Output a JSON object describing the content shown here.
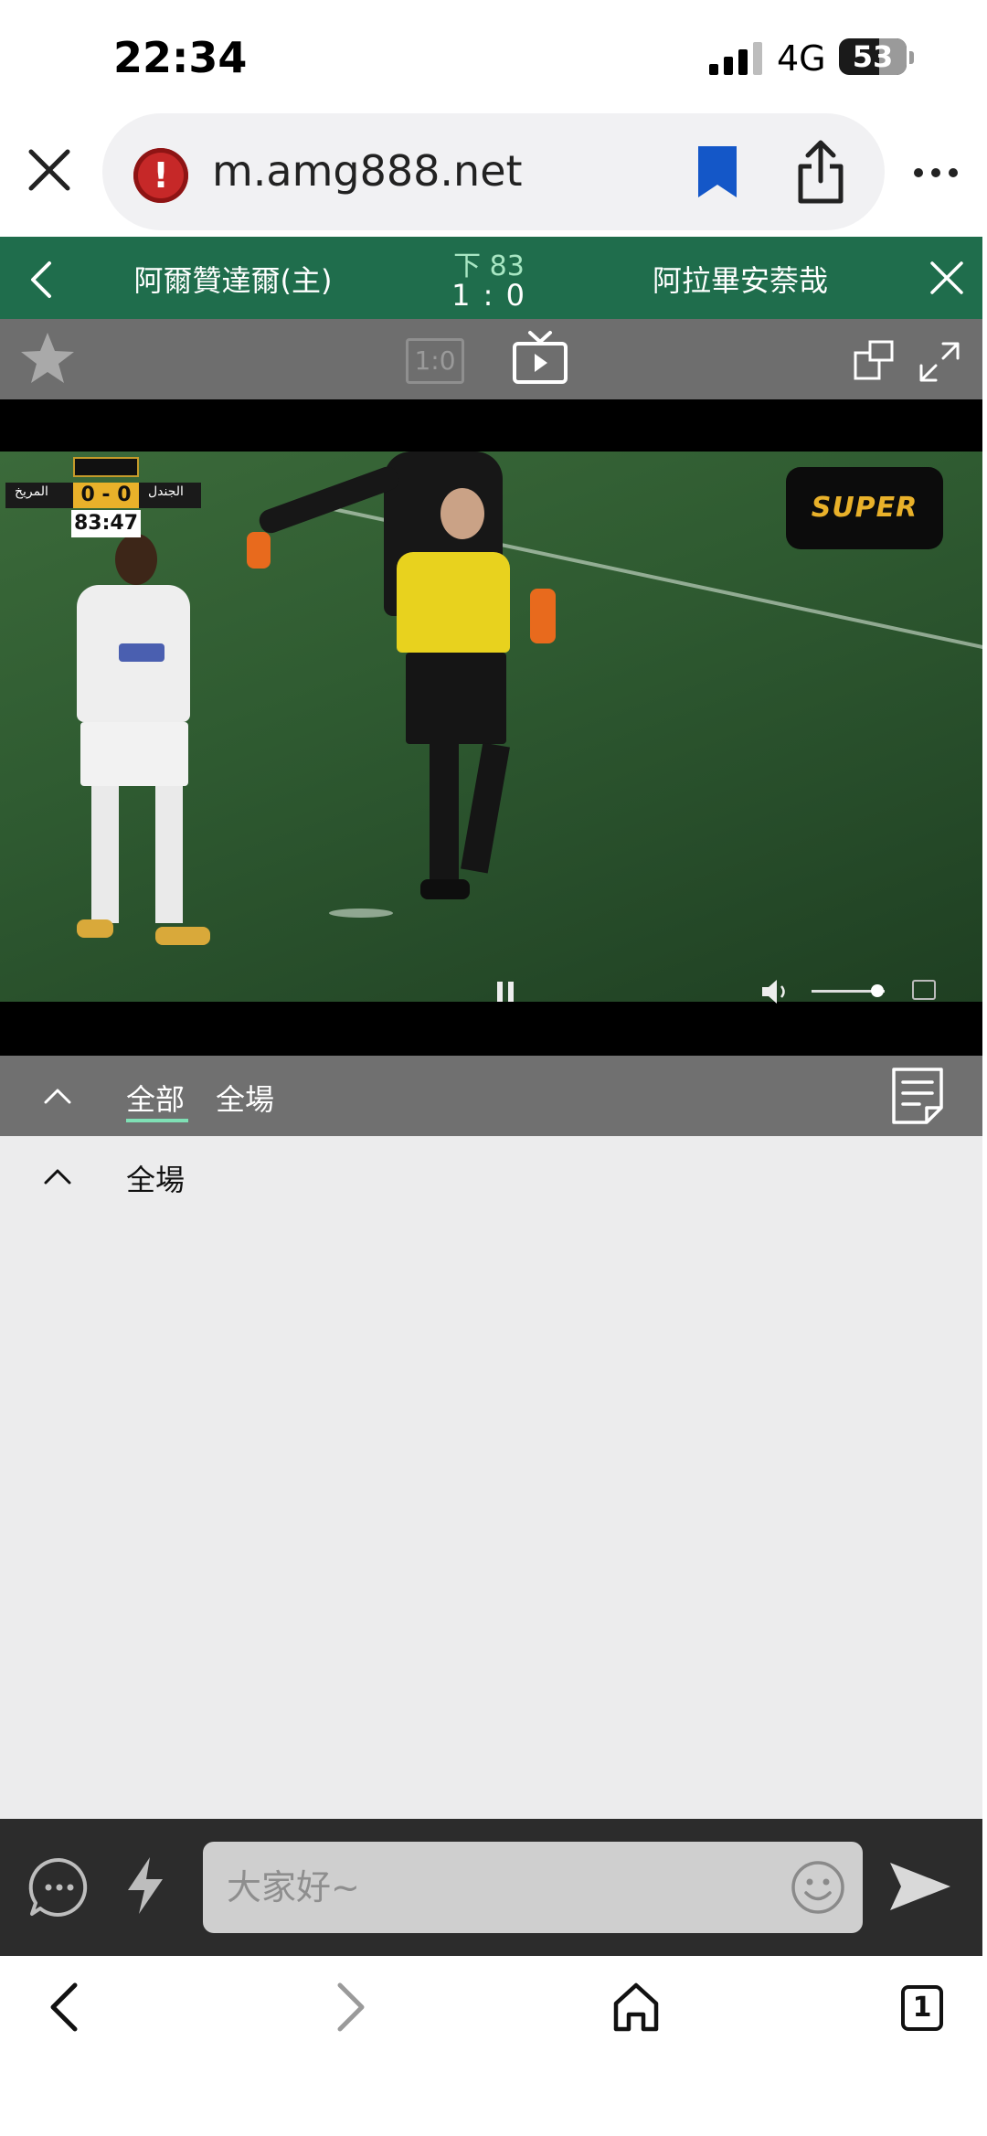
{
  "status_bar": {
    "time": "22:34",
    "network": "4G",
    "battery": "53"
  },
  "browser": {
    "url": "m.amg888.net",
    "warning_icon": "!"
  },
  "match": {
    "home_team": "阿爾贊達爾(主)",
    "away_team": "阿拉畢安萘哉",
    "period": "下 83",
    "score": "1 : 0",
    "score_icon_label": "1:0"
  },
  "video": {
    "scorebug_score": "0 - 0",
    "scorebug_clock": "83:47",
    "scorebug_team_left": "المريخ",
    "scorebug_team_right": "الجندل",
    "channel_logo": "SUPER",
    "volume_level": 0.9
  },
  "tabs": [
    {
      "label": "全部",
      "active": true
    },
    {
      "label": "全場",
      "active": false
    }
  ],
  "content": {
    "section_title": "全場"
  },
  "chat": {
    "placeholder": "大家好~"
  },
  "bottom_nav": {
    "tab_count": "1"
  },
  "colors": {
    "match_header_bg": "#1f6d4c",
    "toolbar_bg": "#6e6e6e",
    "tab_underline": "#7fe0b5",
    "chat_bar_bg": "#2c2c2c",
    "bookmark_blue": "#1457c8",
    "warning_red": "#c62828"
  }
}
